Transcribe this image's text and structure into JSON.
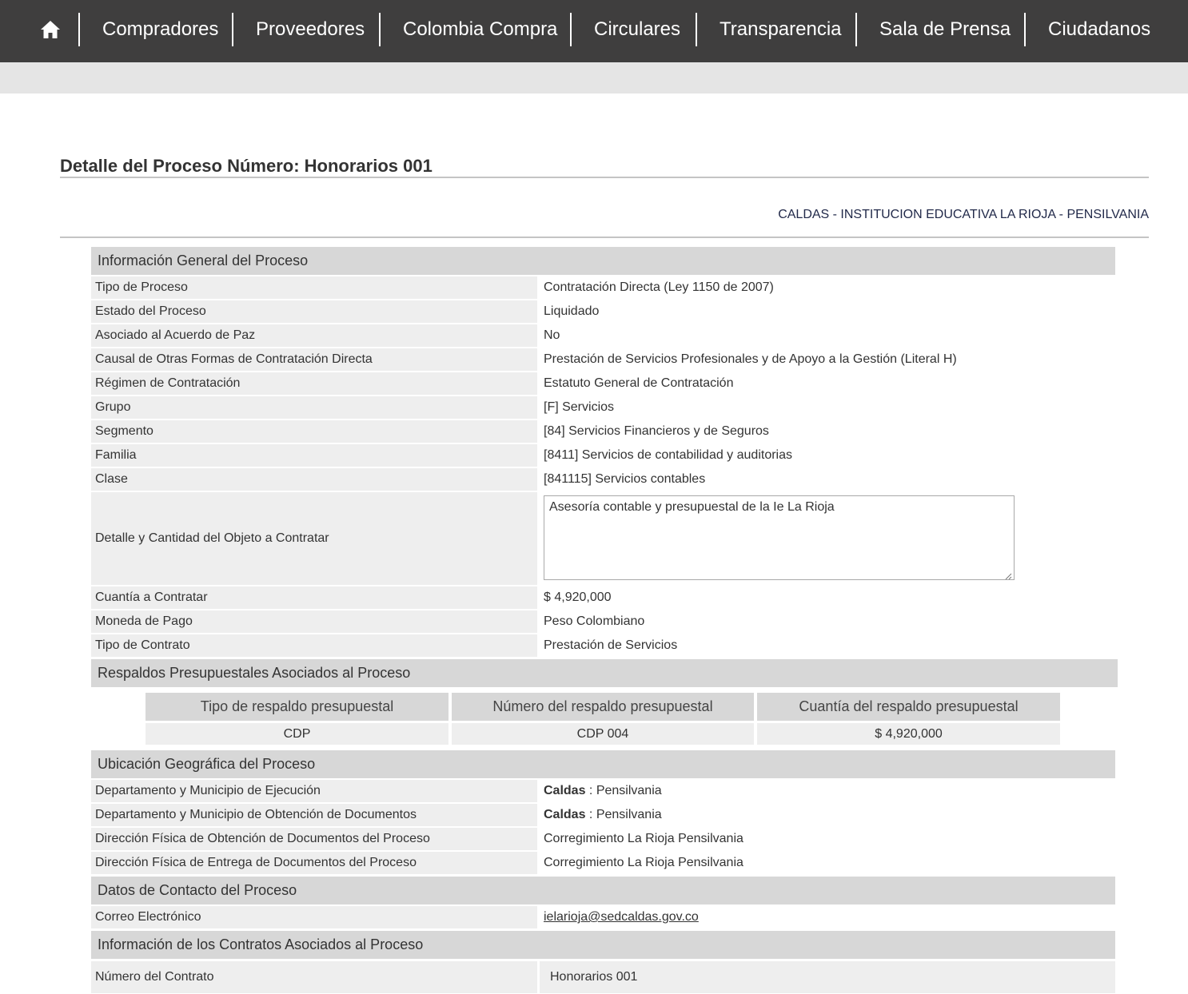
{
  "nav": {
    "home_icon": "home-icon",
    "items": [
      "Compradores",
      "Proveedores",
      "Colombia Compra",
      "Circulares",
      "Transparencia",
      "Sala de Prensa",
      "Ciudadanos"
    ]
  },
  "page": {
    "title": "Detalle del Proceso Número: Honorarios 001",
    "entity": "CALDAS - INSTITUCION EDUCATIVA LA RIOJA - PENSILVANIA"
  },
  "general": {
    "header": "Información General del Proceso",
    "rows": [
      {
        "label": "Tipo de Proceso",
        "value": "Contratación Directa (Ley 1150 de 2007)"
      },
      {
        "label": "Estado del Proceso",
        "value": "Liquidado"
      },
      {
        "label": "Asociado al Acuerdo de Paz",
        "value": "No"
      },
      {
        "label": "Causal de Otras Formas de Contratación Directa",
        "value": "Prestación de Servicios Profesionales y de Apoyo a la Gestión (Literal H)"
      },
      {
        "label": "Régimen de Contratación",
        "value": "Estatuto General de Contratación"
      },
      {
        "label": "Grupo",
        "value": "[F] Servicios"
      },
      {
        "label": "Segmento",
        "value": "[84] Servicios Financieros y de Seguros"
      },
      {
        "label": "Familia",
        "value": "[8411] Servicios de contabilidad y auditorias"
      },
      {
        "label": "Clase",
        "value": "[841115] Servicios contables"
      }
    ],
    "objeto_label": "Detalle y Cantidad del Objeto a Contratar",
    "objeto_value": "Asesoría contable y presupuestal de la Ie La Rioja",
    "rows2": [
      {
        "label": "Cuantía a Contratar",
        "value": "$ 4,920,000"
      },
      {
        "label": "Moneda de Pago",
        "value": "Peso Colombiano"
      },
      {
        "label": "Tipo de Contrato",
        "value": "Prestación de Servicios"
      }
    ]
  },
  "budget": {
    "header": "Respaldos Presupuestales Asociados al Proceso",
    "columns": [
      "Tipo de respaldo presupuestal",
      "Número del respaldo presupuestal",
      "Cuantía del respaldo presupuestal"
    ],
    "row": [
      "CDP",
      "CDP 004",
      "$ 4,920,000"
    ]
  },
  "geo": {
    "header": "Ubicación Geográfica del Proceso",
    "rows": [
      {
        "label": "Departamento y Municipio de Ejecución",
        "dept": "Caldas",
        "sep": " : ",
        "muni": "Pensilvania"
      },
      {
        "label": "Departamento y Municipio de Obtención de Documentos",
        "dept": "Caldas",
        "sep": " : ",
        "muni": "Pensilvania"
      }
    ],
    "rows2": [
      {
        "label": "Dirección Física de Obtención de Documentos del Proceso",
        "value": "Corregimiento La Rioja Pensilvania"
      },
      {
        "label": "Dirección Física de Entrega de Documentos del Proceso",
        "value": "Corregimiento La Rioja Pensilvania"
      }
    ]
  },
  "contact": {
    "header": "Datos de Contacto del Proceso",
    "email_label": "Correo Electrónico",
    "email_value": "ielarioja@sedcaldas.gov.co"
  },
  "contracts": {
    "header": "Información de los Contratos Asociados al Proceso",
    "number_label": "Número del Contrato",
    "number_value": "Honorarios 001"
  }
}
